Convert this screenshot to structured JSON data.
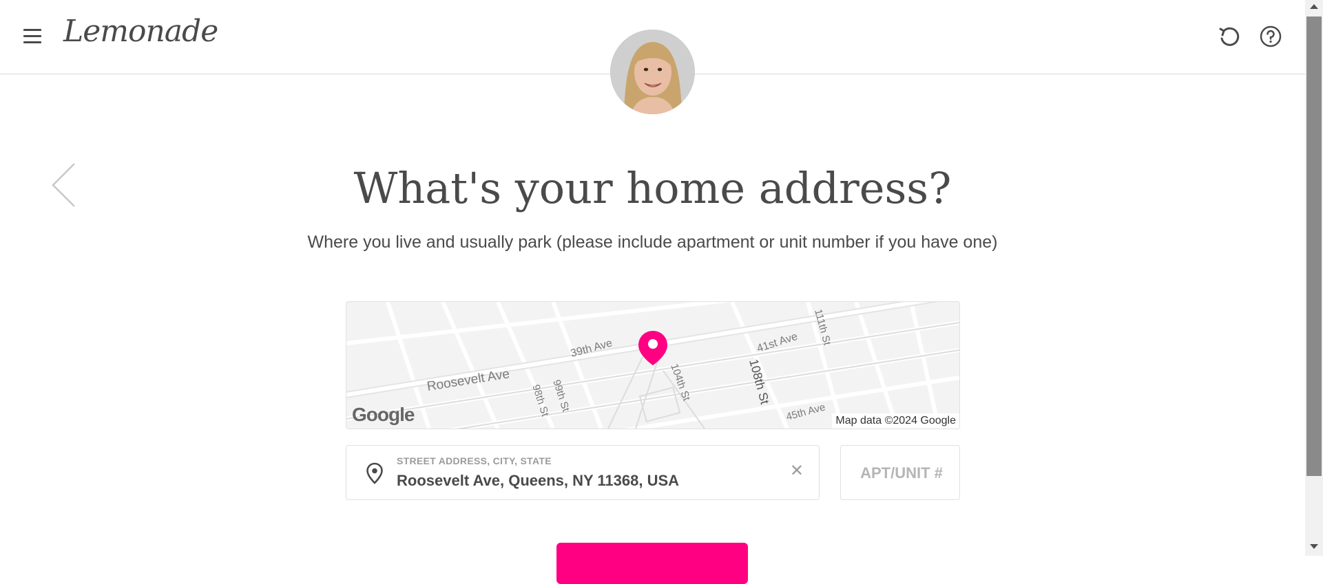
{
  "header": {
    "logo_text": "Lemonade",
    "menu_icon": "hamburger-menu-icon",
    "undo_icon": "undo-icon",
    "help_icon": "help-circle-icon"
  },
  "avatar": {
    "icon": "agent-avatar"
  },
  "question": {
    "title": "What's your home address?",
    "subtitle": "Where you live and usually park (please include apartment or unit number if you have one)"
  },
  "map": {
    "streets": [
      "39th Ave",
      "41st Ave",
      "111th St",
      "Roosevelt Ave",
      "104th St",
      "108th St",
      "98th St",
      "99th St",
      "45th Ave"
    ],
    "attribution": "Map data ©2024 Google",
    "google_logo": "Google",
    "pin_color": "#ff0083"
  },
  "address_field": {
    "label": "STREET ADDRESS, CITY, STATE",
    "value": "Roosevelt Ave, Queens, NY 11368, USA",
    "clear_icon": "close-icon"
  },
  "apt_field": {
    "placeholder": "APT/UNIT #"
  },
  "colors": {
    "accent": "#ff0083",
    "text": "#4a4a4a",
    "muted": "#9b9b9b"
  }
}
